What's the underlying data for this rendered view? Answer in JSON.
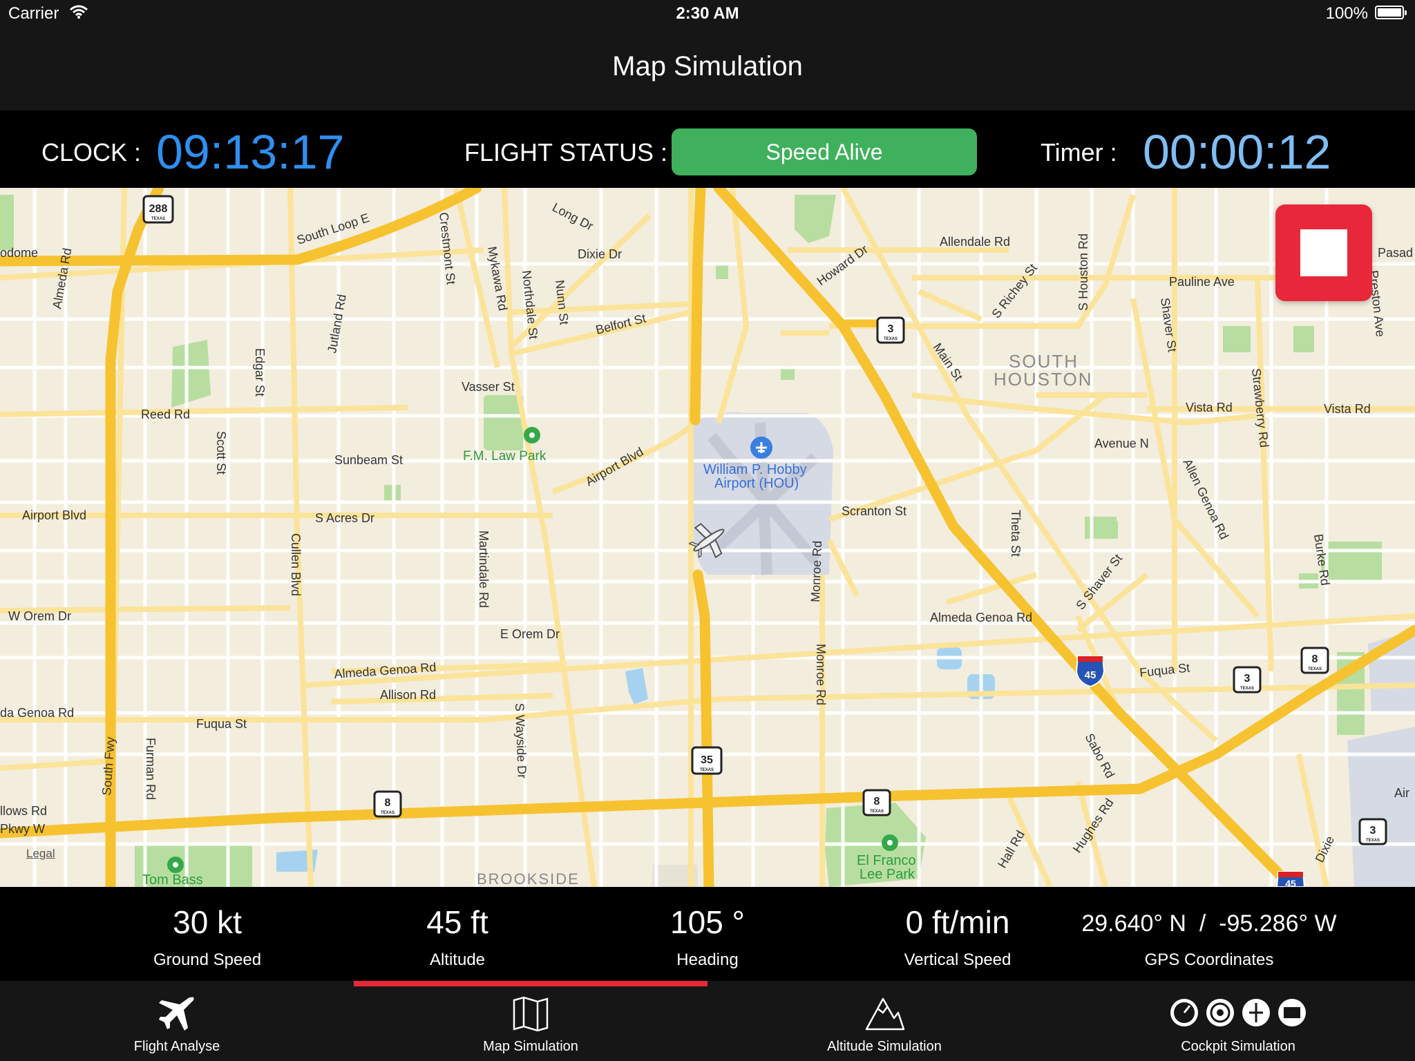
{
  "status_bar": {
    "carrier": "Carrier",
    "time": "2:30 AM",
    "battery": "100%"
  },
  "nav": {
    "title": "Map Simulation"
  },
  "info": {
    "clock_label": "CLOCK :",
    "clock_value": "09:13:17",
    "flight_status_label": "FLIGHT STATUS :",
    "flight_status_value": "Speed Alive",
    "timer_label": "Timer :",
    "timer_value": "00:00:12"
  },
  "map": {
    "labels": {
      "south_loop": "South Loop E",
      "dixie": "Dixie Dr",
      "long": "Long Dr",
      "belfort": "Belfort St",
      "vasser": "Vasser St",
      "reed": "Reed Rd",
      "sunbeam": "Sunbeam St",
      "airport_blvd_w": "Airport Blvd",
      "airport_blvd_e": "Airport Blvd",
      "s_acres": "S Acres Dr",
      "w_orem": "W Orem Dr",
      "e_orem": "E Orem Dr",
      "almeda_genoa": "Almeda Genoa Rd",
      "almeda_genoa_e": "Almeda Genoa Rd",
      "allison": "Allison Rd",
      "fuqua": "Fuqua St",
      "fuqua_e": "Fuqua St",
      "scranton": "Scranton St",
      "vista": "Vista Rd",
      "vista_e": "Vista Rd",
      "avenue_n": "Avenue N",
      "allendale": "Allendale Rd",
      "pauline": "Pauline Ave",
      "fm_law_park": "F.M. Law Park",
      "airport_name": "William P. Hobby",
      "airport_code": "Airport (HOU)",
      "south_houston_1": "SOUTH",
      "south_houston_2": "HOUSTON",
      "el_franco_1": "El Franco",
      "el_franco_2": "Lee Park",
      "tom_bass": "Tom Bass",
      "brookside": "BROOKSIDE",
      "almeda_rd": "Almeda Rd",
      "edgar": "Edgar St",
      "scott": "Scott St",
      "cullen": "Cullen Blvd",
      "martindale": "Martindale Rd",
      "monroe": "Monroe Rd",
      "monroe2": "Monroe Rd",
      "theta": "Theta St",
      "jutland": "Jutland Rd",
      "crestmont": "Crestmont St",
      "mykawa": "Mykawa Rd",
      "northdale": "Northdale St",
      "nunn": "Nunn St",
      "s_wayside": "S Wayside Dr",
      "furman": "Furman Rd",
      "south_fwy": "South Fwy",
      "howard": "Howard Dr",
      "main": "Main St",
      "s_richey": "S Richey St",
      "s_houston": "S Houston Rd",
      "shaver": "Shaver St",
      "strawberry": "Strawberry Rd",
      "allen_genoa": "Allen Genoa Rd",
      "burke": "Burke Rd",
      "s_shaver": "S Shaver St",
      "sabo": "Sabo Rd",
      "hughes": "Hughes Rd",
      "hall": "Hall Rd",
      "dixie_e": "Dixie",
      "preston": "Preston Ave",
      "pasad": "Pasad",
      "air": "Air",
      "odome": "odome",
      "lows": "llows Rd",
      "pkwy": "Pkwy W",
      "da_genoa": "da Genoa Rd"
    },
    "shields": {
      "s288": "288",
      "s3a": "3",
      "s3b": "3",
      "s3c": "3",
      "s8a": "8",
      "s8b": "8",
      "s8c": "8",
      "s35": "35",
      "i45": "45",
      "i45b": "45"
    },
    "shield_sub": "TEXAS",
    "legal": "Legal"
  },
  "telemetry": {
    "ground_speed": {
      "value": "30 kt",
      "label": "Ground Speed"
    },
    "altitude": {
      "value": "45 ft",
      "label": "Altitude"
    },
    "heading": {
      "value": "105 °",
      "label": "Heading"
    },
    "vertical_speed": {
      "value": "0 ft/min",
      "label": "Vertical Speed"
    },
    "gps": {
      "value": "29.640° N  /  -95.286° W",
      "label": "GPS Coordinates"
    }
  },
  "tabs": [
    {
      "label": "Flight Analyse",
      "icon": "airplane-icon"
    },
    {
      "label": "Map Simulation",
      "icon": "map-icon"
    },
    {
      "label": "Altitude Simulation",
      "icon": "mountain-icon"
    },
    {
      "label": "Cockpit Simulation",
      "icon": "cockpit-instruments-icon"
    }
  ],
  "colors": {
    "clock": "#2f8ff0",
    "timer": "#7fbdf5",
    "status_pill": "#3fb15c",
    "stop_button": "#e8283a",
    "map_bg": "#f3eddd",
    "highway": "#f7c32e",
    "road": "#fbe39a"
  }
}
